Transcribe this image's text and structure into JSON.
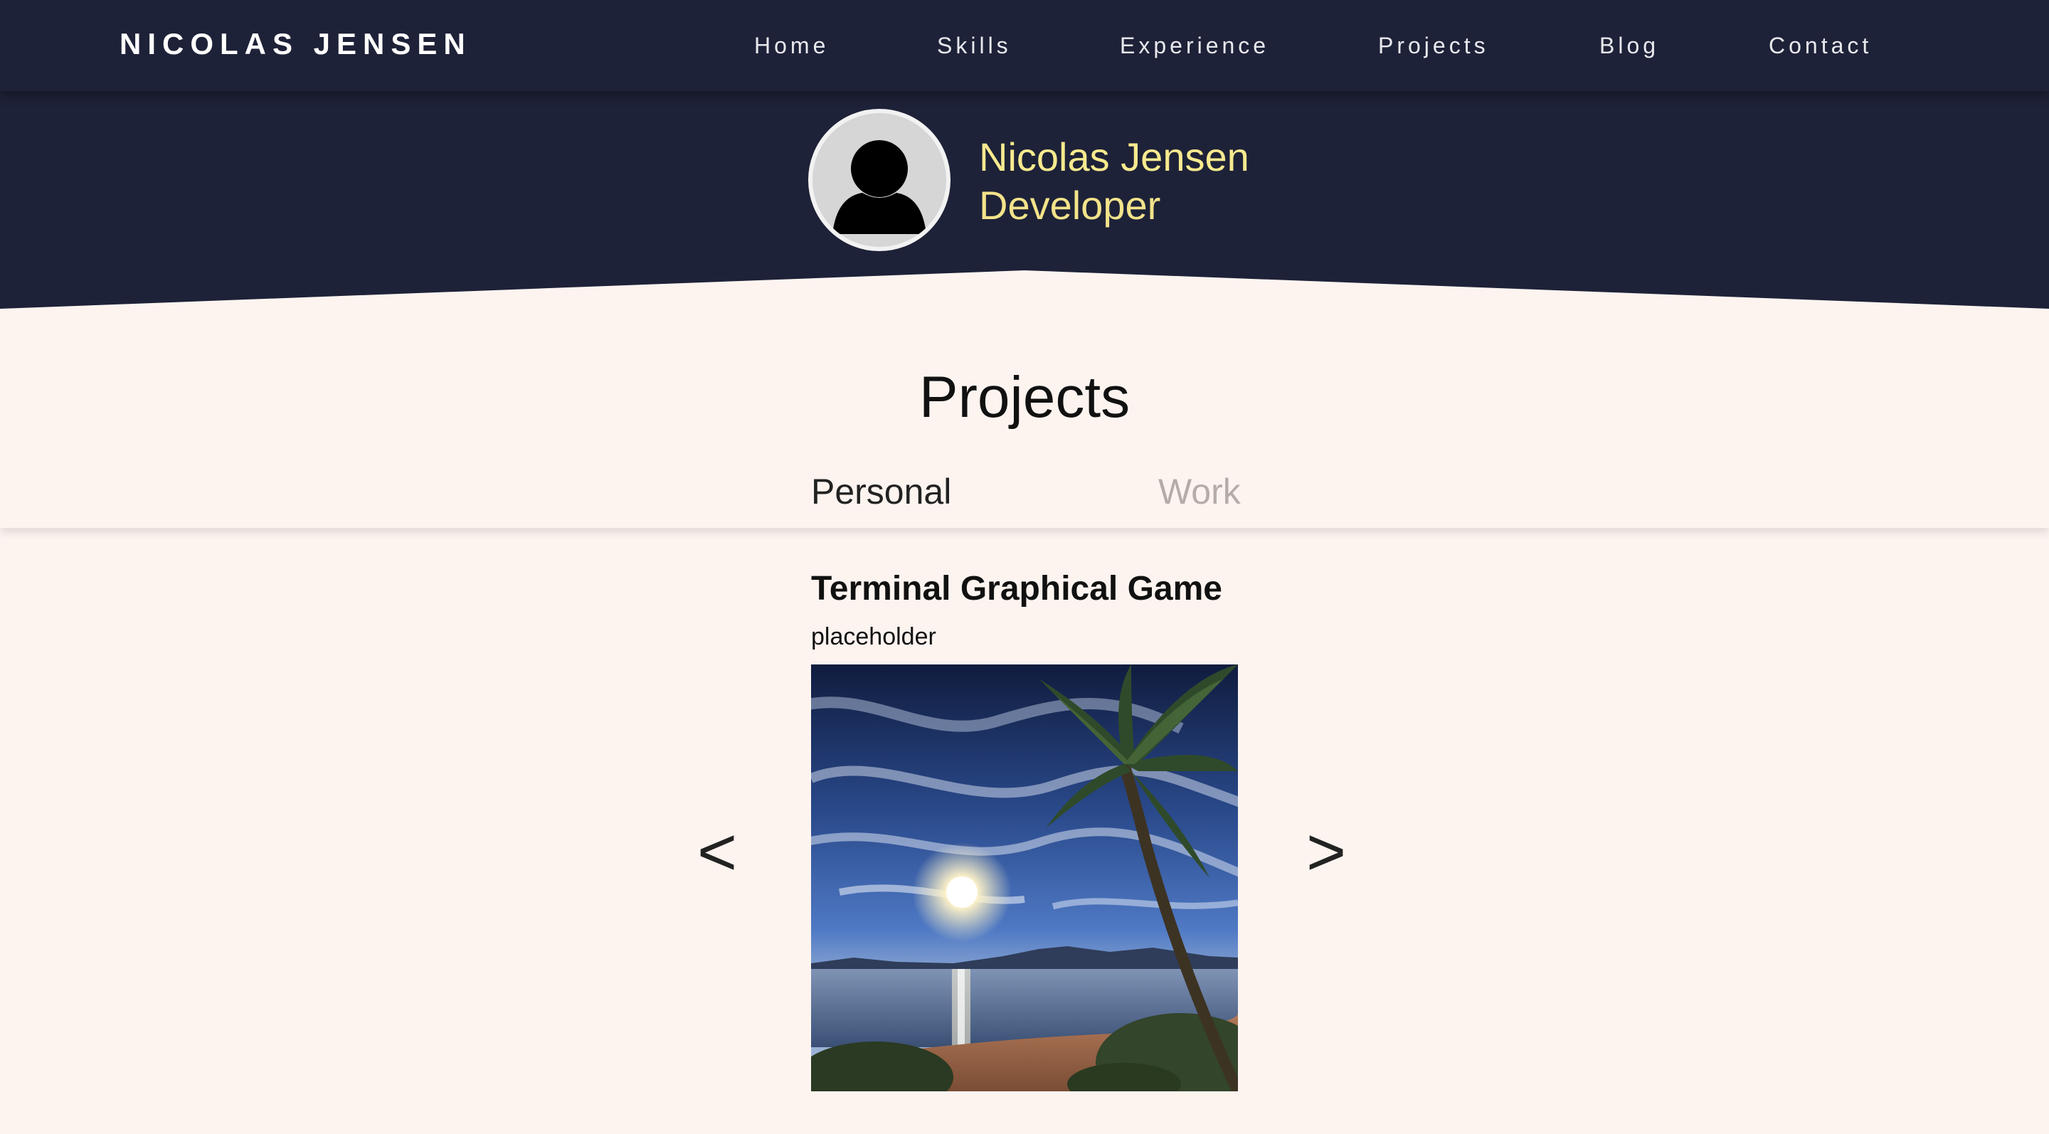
{
  "nav": {
    "brand": "NICOLAS JENSEN",
    "links": [
      "Home",
      "Skills",
      "Experience",
      "Projects",
      "Blog",
      "Contact"
    ]
  },
  "profile": {
    "name": "Nicolas Jensen",
    "role": "Developer",
    "avatar_icon": "user-silhouette-icon"
  },
  "projects": {
    "title": "Projects",
    "tabs": [
      "Personal",
      "Work"
    ],
    "active_tab": "Personal",
    "item": {
      "title": "Terminal Graphical Game",
      "description": "placeholder"
    },
    "prev_label": "<",
    "next_label": ">"
  },
  "colors": {
    "navy": "#1e2238",
    "accent_yellow": "#f8ea8e",
    "background": "#fdf4f0",
    "inactive_tab": "#b3aca9"
  }
}
